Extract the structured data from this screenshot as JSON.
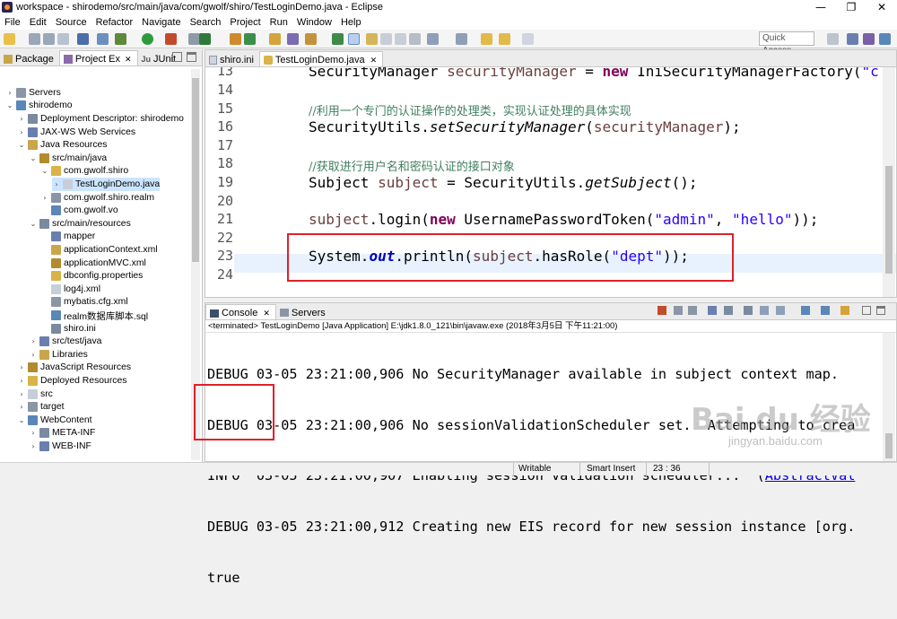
{
  "window": {
    "title": "workspace - shirodemo/src/main/java/com/gwolf/shiro/TestLoginDemo.java - Eclipse"
  },
  "menu": [
    "File",
    "Edit",
    "Source",
    "Refactor",
    "Navigate",
    "Search",
    "Project",
    "Run",
    "Window",
    "Help"
  ],
  "quick_access": {
    "placeholder": "Quick Access"
  },
  "left_tabs": [
    {
      "label": "Package"
    },
    {
      "label": "Project Ex"
    },
    {
      "label": "JUnit"
    }
  ],
  "tree": [
    {
      "label": "Servers",
      "depth": 0,
      "expand": ">"
    },
    {
      "label": "shirodemo",
      "depth": 0,
      "expand": "v"
    },
    {
      "label": "Deployment Descriptor: shirodemo",
      "depth": 1,
      "expand": ">"
    },
    {
      "label": "JAX-WS Web Services",
      "depth": 1,
      "expand": ">"
    },
    {
      "label": "Java Resources",
      "depth": 1,
      "expand": "v"
    },
    {
      "label": "src/main/java",
      "depth": 2,
      "expand": "v"
    },
    {
      "label": "com.gwolf.shiro",
      "depth": 3,
      "expand": "v"
    },
    {
      "label": "TestLoginDemo.java",
      "depth": 4,
      "expand": ">",
      "selected": true
    },
    {
      "label": "com.gwolf.shiro.realm",
      "depth": 3,
      "expand": ">"
    },
    {
      "label": "com.gwolf.vo",
      "depth": 3,
      "expand": ""
    },
    {
      "label": "src/main/resources",
      "depth": 2,
      "expand": "v"
    },
    {
      "label": "mapper",
      "depth": 3,
      "expand": ""
    },
    {
      "label": "applicationContext.xml",
      "depth": 3,
      "expand": ""
    },
    {
      "label": "applicationMVC.xml",
      "depth": 3,
      "expand": ""
    },
    {
      "label": "dbconfig.properties",
      "depth": 3,
      "expand": ""
    },
    {
      "label": "log4j.xml",
      "depth": 3,
      "expand": ""
    },
    {
      "label": "mybatis.cfg.xml",
      "depth": 3,
      "expand": ""
    },
    {
      "label": "realm数据库脚本.sql",
      "depth": 3,
      "expand": ""
    },
    {
      "label": "shiro.ini",
      "depth": 3,
      "expand": ""
    },
    {
      "label": "src/test/java",
      "depth": 2,
      "expand": ">"
    },
    {
      "label": "Libraries",
      "depth": 2,
      "expand": ">"
    },
    {
      "label": "JavaScript Resources",
      "depth": 1,
      "expand": ">"
    },
    {
      "label": "Deployed Resources",
      "depth": 1,
      "expand": ">"
    },
    {
      "label": "src",
      "depth": 1,
      "expand": ">"
    },
    {
      "label": "target",
      "depth": 1,
      "expand": ">"
    },
    {
      "label": "WebContent",
      "depth": 1,
      "expand": "v"
    },
    {
      "label": "META-INF",
      "depth": 2,
      "expand": ">"
    },
    {
      "label": "WEB-INF",
      "depth": 2,
      "expand": ">"
    }
  ],
  "editor_tabs": [
    {
      "label": "shiro.ini"
    },
    {
      "label": "TestLoginDemo.java",
      "close": "✕"
    }
  ],
  "code": {
    "l13": {
      "num": "13",
      "a": "SecurityManager ",
      "b": "securityManager",
      "c": " = ",
      "d": "new",
      "e": " IniSecurityManagerFactory(",
      "f": "\"c"
    },
    "l14": {
      "num": "14"
    },
    "l15": {
      "num": "15",
      "comment": "//利用一个专门的认证操作的处理类，实现认证处理的具体实现"
    },
    "l16": {
      "num": "16",
      "a": "SecurityUtils.",
      "b": "setSecurityManager",
      "c": "(",
      "d": "securityManager",
      "e": ");"
    },
    "l17": {
      "num": "17"
    },
    "l18": {
      "num": "18",
      "comment": "//获取进行用户名和密码认证的接口对象"
    },
    "l19": {
      "num": "19",
      "a": "Subject ",
      "b": "subject",
      "c": " = SecurityUtils.",
      "d": "getSubject",
      "e": "();"
    },
    "l20": {
      "num": "20"
    },
    "l21": {
      "num": "21",
      "a": "subject",
      "b": ".login(",
      "c": "new",
      "d": " UsernamePasswordToken(",
      "e": "\"admin\"",
      "f": ", ",
      "g": "\"hello\"",
      "h": "));"
    },
    "l22": {
      "num": "22"
    },
    "l23": {
      "num": "23",
      "a": "System.",
      "b": "out",
      "c": ".println(",
      "d": "subject",
      "e": ".hasRole(",
      "f": "\"dept\"",
      "g": "));"
    },
    "l24": {
      "num": "24"
    }
  },
  "console_tabs": [
    {
      "label": "Console",
      "close": "✕"
    },
    {
      "label": "Servers"
    }
  ],
  "console_status": "<terminated> TestLoginDemo [Java Application] E:\\jdk1.8.0_121\\bin\\javaw.exe (2018年3月5日 下午11:21:00)",
  "console_lines": [
    "DEBUG 03-05 23:21:00,906 No SecurityManager available in subject context map.",
    "DEBUG 03-05 23:21:00,906 No sessionValidationScheduler set.  Attempting to crea",
    {
      "text": "INFO  03-05 23:21:00,907 Enabling session validation scheduler...  (",
      "link": "AbstractVal"
    },
    "DEBUG 03-05 23:21:00,912 Creating new EIS record for new session instance [org.",
    "true"
  ],
  "status_bar": {
    "mode": "Writable",
    "insert": "Smart Insert",
    "pos": "23 : 36"
  },
  "watermark": {
    "logo": "Bai du 经验",
    "url": "jingyan.baidu.com"
  },
  "colors": {
    "highlight_box": "#e0202a",
    "keyword": "#7f0055",
    "string": "#2a00ff",
    "comment": "#3f7f5f",
    "field": "#0000c0"
  }
}
